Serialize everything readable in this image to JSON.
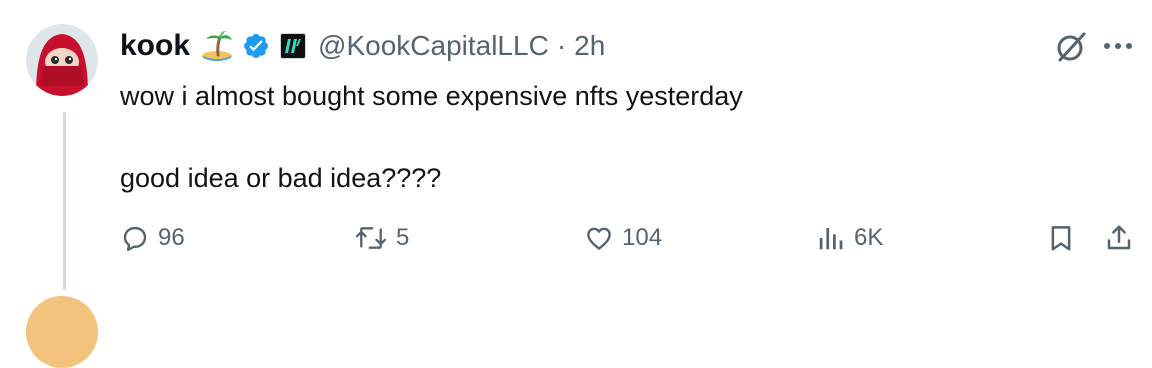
{
  "post": {
    "author": {
      "display_name": "kook",
      "name_emoji_icon": "desert-island-icon",
      "verified_icon": "verified-badge-icon",
      "affiliation_icon": "kook-capital-logo-icon",
      "handle": "@KookCapitalLLC",
      "separator": "·",
      "time": "2h"
    },
    "text_line_1": "wow i almost bought some expensive nfts yesterday",
    "text_line_2": "good idea or bad idea????",
    "actions": {
      "replies": "96",
      "reposts": "5",
      "likes": "104",
      "views": "6K"
    }
  },
  "colors": {
    "text": "#0f1419",
    "secondary": "#536471",
    "verified_blue": "#1d9bf0",
    "thread_line": "#cfd9de",
    "avatar_red": "#c8102e"
  }
}
